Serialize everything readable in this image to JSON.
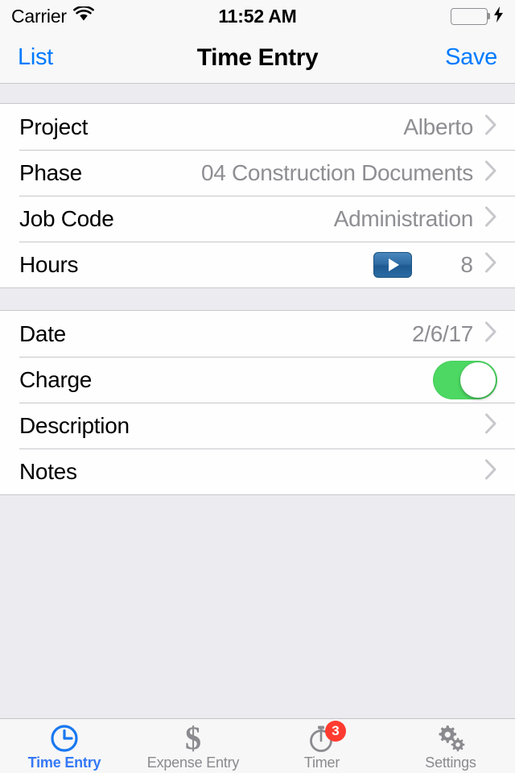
{
  "status_bar": {
    "carrier": "Carrier",
    "wifi_icon": "wifi-icon",
    "time": "11:52 AM",
    "battery_icon": "battery-full-icon",
    "charging_icon": "lightning-bolt-icon",
    "battery_color": "#3ddc4b"
  },
  "nav_bar": {
    "back_label": "List",
    "title": "Time Entry",
    "save_label": "Save",
    "tint_color": "#007aff"
  },
  "form": {
    "section_one": [
      {
        "label": "Project",
        "value": "Alberto",
        "accessory": "chevron-right-icon"
      },
      {
        "label": "Phase",
        "value": "04 Construction Documents",
        "accessory": "chevron-right-icon"
      },
      {
        "label": "Job Code",
        "value": "Administration",
        "accessory": "chevron-right-icon"
      },
      {
        "label": "Hours",
        "value": "8",
        "accessory": "chevron-right-icon",
        "control": "play-button"
      }
    ],
    "section_two": [
      {
        "label": "Date",
        "value": "2/6/17",
        "accessory": "chevron-right-icon"
      },
      {
        "label": "Charge",
        "value": "",
        "control": "toggle-switch",
        "toggle_on": true
      },
      {
        "label": "Description",
        "value": "",
        "accessory": "chevron-right-icon"
      },
      {
        "label": "Notes",
        "value": "",
        "accessory": "chevron-right-icon"
      }
    ]
  },
  "colors": {
    "toggle_on": "#4cd862",
    "badge": "#ff3b30",
    "active_tab": "#3478f6",
    "inactive_tab": "#8a8a8f",
    "play_button": "#2f6ca5",
    "value_text": "#8e8e93"
  },
  "tab_bar": {
    "tabs": [
      {
        "label": "Time Entry",
        "icon": "clock-icon",
        "active": true,
        "badge": ""
      },
      {
        "label": "Expense Entry",
        "icon": "dollar-icon",
        "active": false,
        "badge": ""
      },
      {
        "label": "Timer",
        "icon": "stopwatch-icon",
        "active": false,
        "badge": "3"
      },
      {
        "label": "Settings",
        "icon": "gears-icon",
        "active": false,
        "badge": ""
      }
    ]
  }
}
